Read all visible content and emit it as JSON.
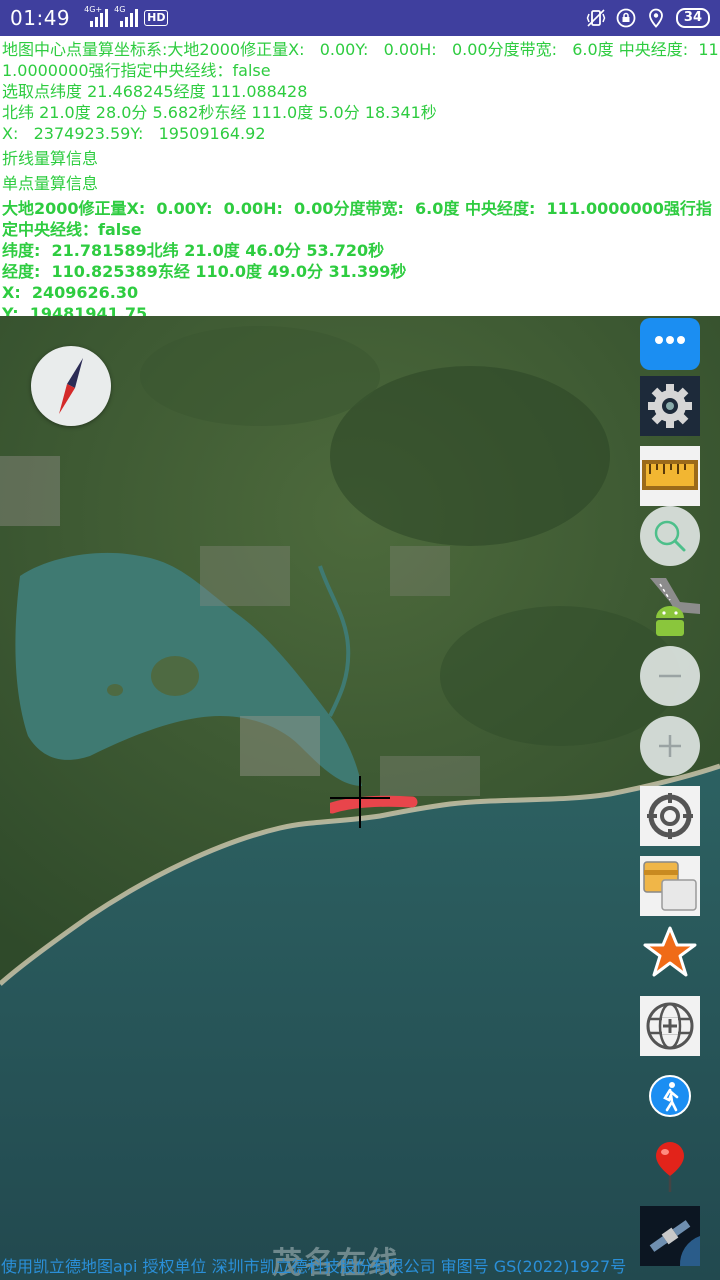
{
  "status_bar": {
    "time": "01:49",
    "network1": "4G+",
    "network2": "4G",
    "hd": "HD",
    "battery": "34",
    "icons": [
      "signal-icon",
      "signal-icon",
      "hd-icon",
      "vibrate-icon",
      "lock-icon",
      "location-icon",
      "battery-icon"
    ]
  },
  "info": {
    "line1": "地图中心点量算坐标系:大地2000修正量X:   0.00Y:   0.00H:   0.00分度带宽:   6.0度 中央经度:  111.0000000强行指定中央经线：false",
    "line2": "选取点纬度 21.468245经度 111.088428",
    "line3": "北纬 21.0度 28.0分 5.682秒东经 111.0度 5.0分 18.341秒",
    "line4": "X:   2374923.59Y:   19509164.92",
    "line5": "折线量算信息",
    "line6": "单点量算信息",
    "line7": "大地2000修正量X:  0.00Y:  0.00H:  0.00分度带宽:  6.0度 中央经度:  111.0000000强行指定中央经线：false",
    "line8": "纬度:  21.781589北纬 21.0度 46.0分 53.720秒",
    "line9": "经度:  110.825389东经 110.0度 49.0分 31.399秒",
    "line10": "X:  2409626.30",
    "line11": "Y:  19481941.75"
  },
  "map": {
    "toolbar": [
      {
        "name": "chat-icon"
      },
      {
        "name": "gear-icon"
      },
      {
        "name": "ruler-icon"
      },
      {
        "name": "search-icon"
      },
      {
        "name": "android-road-icon"
      },
      {
        "name": "zoom-out-icon"
      },
      {
        "name": "zoom-in-icon"
      },
      {
        "name": "target-icon"
      },
      {
        "name": "layers-icon"
      },
      {
        "name": "star-icon"
      },
      {
        "name": "globe-plus-icon"
      },
      {
        "name": "walk-icon"
      },
      {
        "name": "map-pin-icon"
      },
      {
        "name": "satellite-icon"
      }
    ],
    "watermark": "茂名在线"
  },
  "footer": {
    "text": "使用凯立德地图api 授权单位 深圳市凯立德科技股份有限公司 审图号 GS(2022)1927号"
  },
  "colors": {
    "status_bar": "#3f3f9e",
    "info_text": "#2ecc40",
    "footer_text": "#2a8fd8",
    "measure_line": "#e8454b"
  }
}
